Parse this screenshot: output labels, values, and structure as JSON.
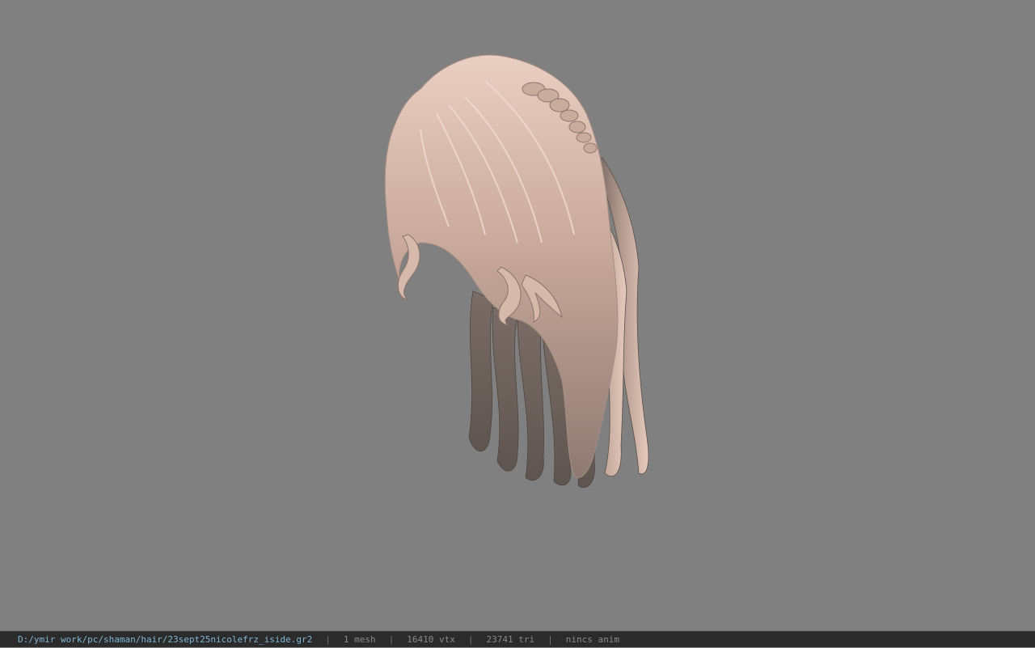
{
  "viewport": {
    "background": "#808080",
    "model_name": "hair-mesh-icon"
  },
  "statusbar": {
    "file_path": "D:/ymir work/pc/shaman/hair/23sept25nicolefrz_iside.gr2",
    "separator": "|",
    "mesh_count": "1 mesh",
    "vertex_count": "16410 vtx",
    "triangle_count": "23741 tri",
    "anim": "nincs anim",
    "path_color": "#7fb6d6",
    "text_color": "#8a8a8a"
  }
}
